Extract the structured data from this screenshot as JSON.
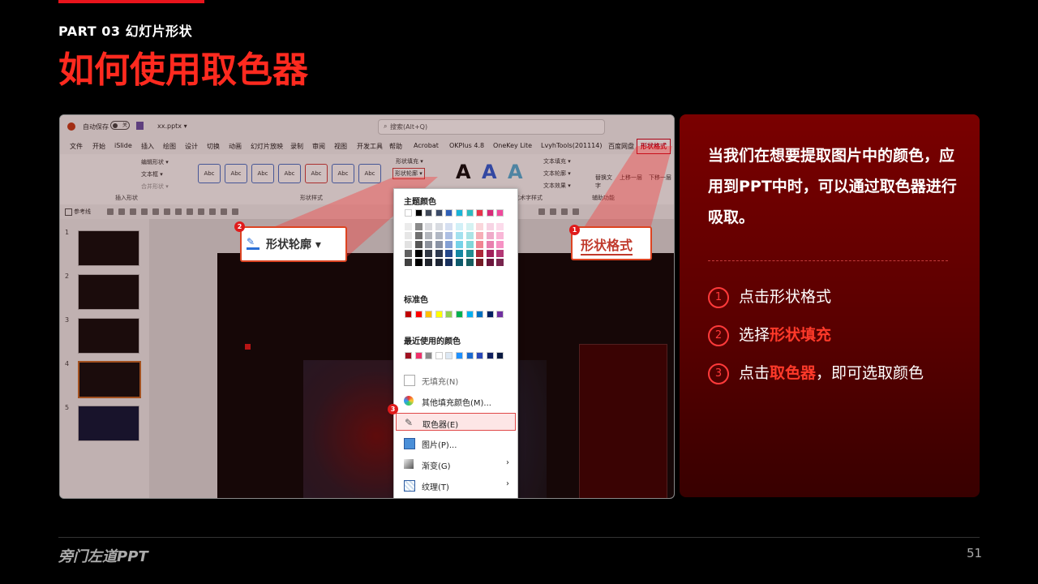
{
  "header": {
    "part": "PART 03  幻灯片形状",
    "title": "如何使用取色器"
  },
  "screenshot": {
    "titlebar": {
      "autosave": "自动保存",
      "toggle": "关",
      "filename": "xx.pptx ▾",
      "search_placeholder": "搜索(Alt+Q)"
    },
    "menu": [
      "文件",
      "开始",
      "iSlide",
      "插入",
      "绘图",
      "设计",
      "切换",
      "动画",
      "幻灯片放映",
      "录制",
      "审阅",
      "视图",
      "开发工具",
      "帮助",
      "Acrobat",
      "OKPlus 4.8",
      "OneKey Lite",
      "LvyhTools(201114)",
      "百度网盘",
      "形状格式"
    ],
    "ribbon": {
      "insert_shape_group": "插入形状",
      "edit_shape": "编辑形状 ▾",
      "textbox": "文本框 ▾",
      "merge_shape": "合并形状 ▾",
      "shape_styles_group": "形状样式",
      "style_label": "Abc",
      "shape_fill": "形状填充 ▾",
      "shape_outline": "形状轮廓 ▾",
      "text_fill": "文本填充 ▾",
      "text_outline": "文本轮廓 ▾",
      "text_effect": "文本效果 ▾",
      "art_group": "艺术字样式",
      "replace_text": "替换文字",
      "aux_group": "辅助功能",
      "bring_forward": "上移一层",
      "send_backward": "下移一层"
    },
    "quickbar": {
      "reference_line": "参考线"
    },
    "thumbnails": [
      "1",
      "2",
      "3",
      "4",
      "5"
    ],
    "callout_outline": "形状轮廓 ▾",
    "callout_format": "形状格式",
    "badges": [
      "1",
      "2",
      "3"
    ],
    "dropdown": {
      "theme_colors": "主题颜色",
      "standard_colors": "标准色",
      "recent_colors": "最近使用的颜色",
      "items": [
        {
          "label": "无填充(N)",
          "icon": "no-fill-icon"
        },
        {
          "label": "其他填充颜色(M)...",
          "icon": "palette-icon"
        },
        {
          "label": "取色器(E)",
          "icon": "eyedropper-icon"
        },
        {
          "label": "图片(P)...",
          "icon": "picture-icon"
        },
        {
          "label": "渐变(G)",
          "icon": "gradient-icon"
        },
        {
          "label": "纹理(T)",
          "icon": "texture-icon"
        }
      ],
      "theme_top": [
        "#ffffff",
        "#000000",
        "#404858",
        "#3a4a68",
        "#2f5fb8",
        "#19b4d8",
        "#2dbcc0",
        "#e8344a",
        "#d82a78",
        "#f04a9c"
      ],
      "standard": [
        "#c00000",
        "#ff0000",
        "#ffc000",
        "#ffff00",
        "#92d050",
        "#00b050",
        "#00b0f0",
        "#0070c0",
        "#002060",
        "#7030a0"
      ],
      "recent": [
        "#a01020",
        "#f0306a",
        "#8a8a8a",
        "#ffffff",
        "#dde8f4",
        "#1e90ff",
        "#1a6ad0",
        "#2848b8",
        "#102060",
        "#0a1a40"
      ]
    }
  },
  "panel": {
    "intro": "当我们在想要提取图片中的颜色，应用到PPT中时，可以通过取色器进行吸取。",
    "steps": [
      {
        "num": "1",
        "pre": "点击形状格式",
        "hl": "",
        "post": ""
      },
      {
        "num": "2",
        "pre": "选择",
        "hl": "形状填充",
        "post": ""
      },
      {
        "num": "3",
        "pre": "点击",
        "hl": "取色器",
        "post": "，即可选取颜色"
      }
    ]
  },
  "footer": {
    "brand": "旁门左道PPT",
    "page": "51"
  },
  "colors": {
    "accent": "#ff2a1f",
    "panel": "#6a0000",
    "background": "#000000"
  }
}
